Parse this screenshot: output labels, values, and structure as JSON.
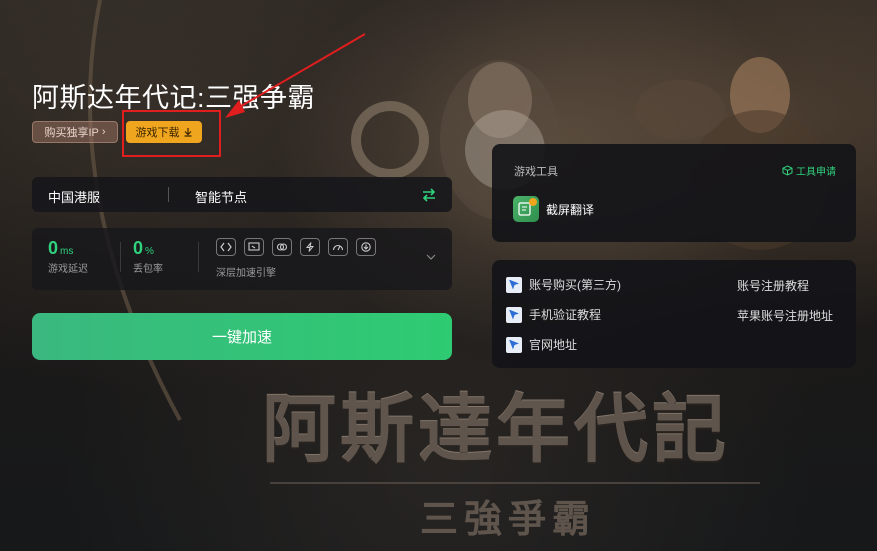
{
  "game": {
    "title": "阿斯达年代记:三强争霸",
    "buy_ip_label": "购买独享IP",
    "download_label": "游戏下载"
  },
  "background_art": {
    "title": "阿斯達年代記",
    "subtitle": "三強爭霸"
  },
  "server": {
    "region": "中国港服",
    "node": "智能节点"
  },
  "stats": {
    "latency_value": "0",
    "latency_unit": "ms",
    "latency_label": "游戏延迟",
    "loss_value": "0",
    "loss_unit": "%",
    "loss_label": "丢包率",
    "engine_label": "深层加速引擎",
    "engine_icons": [
      "route-icon",
      "screen-icon",
      "link-icon",
      "bolt-icon",
      "speed-icon",
      "download-icon"
    ]
  },
  "accelerate": {
    "label": "一键加速"
  },
  "tools": {
    "title": "游戏工具",
    "apply_label": "工具申请",
    "items": [
      {
        "label": "截屏翻译",
        "icon": "screenshot-translate-icon"
      }
    ]
  },
  "links": {
    "left": [
      "账号购买(第三方)",
      "手机验证教程",
      "官网地址"
    ],
    "right": [
      "账号注册教程",
      "苹果账号注册地址"
    ]
  },
  "colors": {
    "accent_green": "#2fd27d",
    "download_orange": "#f0a51e",
    "annotation_red": "#e01e1e"
  }
}
